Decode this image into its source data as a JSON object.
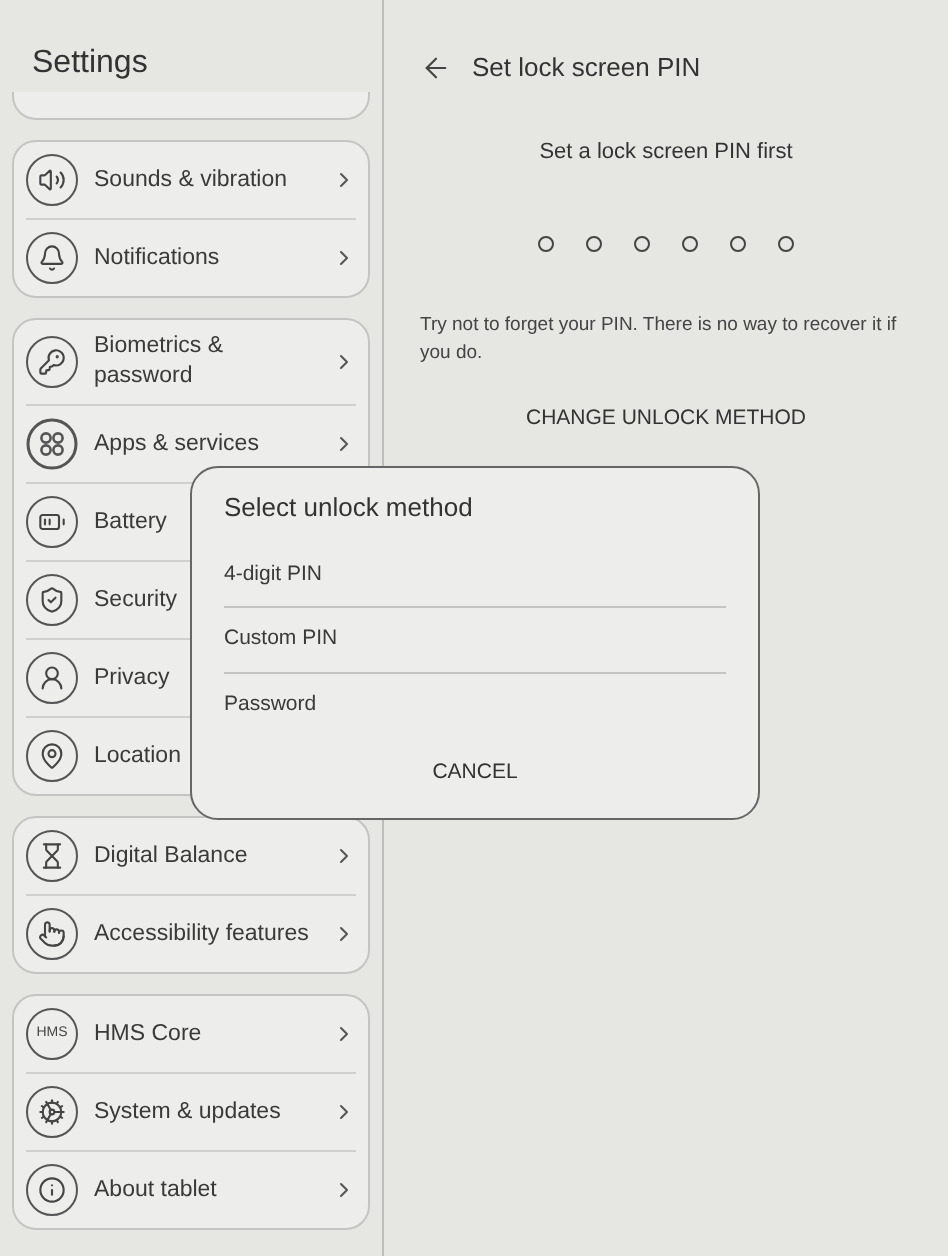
{
  "sidebar": {
    "title": "Settings",
    "groups": [
      {
        "items": [
          {
            "label": "Sounds & vibration"
          },
          {
            "label": "Notifications"
          }
        ]
      },
      {
        "items": [
          {
            "label": "Biometrics & password"
          },
          {
            "label": "Apps & services"
          },
          {
            "label": "Battery"
          },
          {
            "label": "Security"
          },
          {
            "label": "Privacy"
          },
          {
            "label": "Location"
          }
        ]
      },
      {
        "items": [
          {
            "label": "Digital Balance"
          },
          {
            "label": "Accessibility features"
          }
        ]
      },
      {
        "items": [
          {
            "label": "HMS Core",
            "icon_text": "HMS"
          },
          {
            "label": "System & updates"
          },
          {
            "label": "About tablet"
          }
        ]
      }
    ]
  },
  "page": {
    "title": "Set lock screen PIN",
    "subtitle": "Set a lock screen PIN first",
    "pin_dots": [
      {
        "filled": false
      },
      {
        "filled": false
      },
      {
        "filled": false
      },
      {
        "filled": false
      },
      {
        "filled": false
      },
      {
        "filled": false
      }
    ],
    "hint": "Try not to forget your PIN. There is no way to recover it if you do.",
    "action": "CHANGE UNLOCK METHOD"
  },
  "dialog": {
    "title": "Select unlock method",
    "options": [
      {
        "label": "4-digit PIN"
      },
      {
        "label": "Custom PIN"
      },
      {
        "label": "Password"
      }
    ],
    "cancel": "CANCEL"
  }
}
